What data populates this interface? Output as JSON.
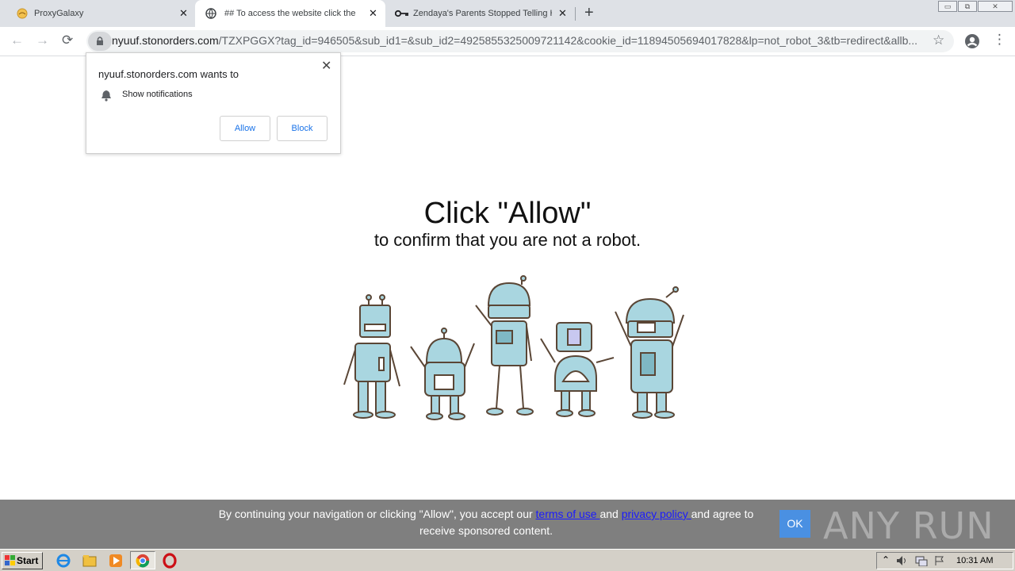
{
  "browser": {
    "tabs": [
      {
        "label": "ProxyGalaxy",
        "close": "✕"
      },
      {
        "label": "## To access the website click the \"A",
        "close": "✕"
      },
      {
        "label": "Zendaya's Parents Stopped Telling H",
        "close": "✕"
      }
    ],
    "new_tab": "+",
    "window_controls": {
      "minimize": "▭",
      "restore": "⧉",
      "close": "✕"
    },
    "nav": {
      "back": "←",
      "forward": "→",
      "reload": "⟳"
    },
    "url_host": "nyuuf.stonorders.com",
    "url_path": "/TZXPGGX?tag_id=946505&sub_id1=&sub_id2=4925855325009721142&cookie_id=11894505694017828&lp=not_robot_3&tb=redirect&allb...",
    "star": "☆",
    "menu": "⋮"
  },
  "popup": {
    "title": "nyuuf.stonorders.com wants to",
    "permission": "Show notifications",
    "allow": "Allow",
    "block": "Block",
    "close": "✕"
  },
  "page": {
    "headline": "Click \"Allow\"",
    "subline": "to confirm that you are not a robot."
  },
  "cookie_bar": {
    "text_before": "By continuing your navigation or clicking \"Allow\", you accept our ",
    "terms_link": "terms of use ",
    "text_and": "and ",
    "privacy_link": "privacy policy ",
    "text_after": "and agree to receive sponsored content.",
    "ok": "OK",
    "watermark": "ANY RUN"
  },
  "taskbar": {
    "start": "Start",
    "clock": "10:31 AM"
  },
  "colors": {
    "robot_fill": "#a9d6e0",
    "robot_stroke": "#5a4636",
    "tab_strip": "#dee1e6",
    "cookie_bar": "#7f7f7f",
    "ok_button": "#4a90e2",
    "link": "#1a1aff"
  }
}
